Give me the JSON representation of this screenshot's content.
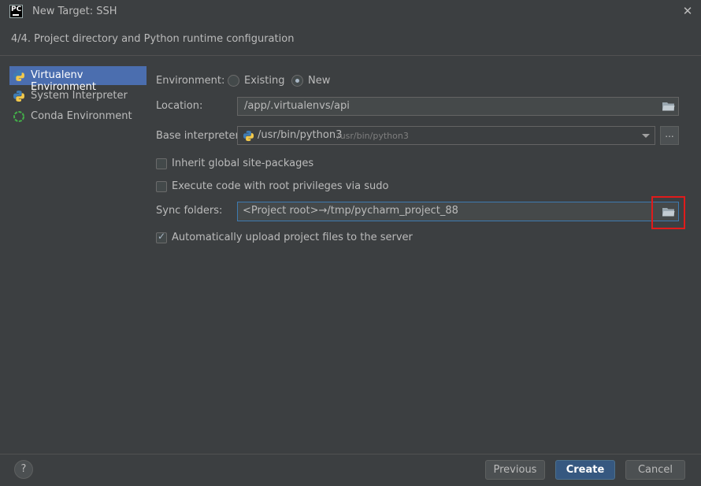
{
  "window": {
    "app_icon_text": "PC",
    "title": "New Target: SSH",
    "close_symbol": "✕"
  },
  "header": {
    "step_title": "4/4. Project directory and Python runtime configuration"
  },
  "sidebar": {
    "items": [
      {
        "label": "Virtualenv Environment",
        "icon": "python-icon",
        "selected": true
      },
      {
        "label": "System Interpreter",
        "icon": "python-icon",
        "selected": false
      },
      {
        "label": "Conda Environment",
        "icon": "conda-icon",
        "selected": false
      }
    ]
  },
  "form": {
    "environment_label": "Environment:",
    "environment_options": [
      {
        "label": "Existing",
        "selected": false
      },
      {
        "label": "New",
        "selected": true
      }
    ],
    "location_label": "Location:",
    "location_value": "/app/.virtualenvs/api",
    "base_interpreter_label": "Base interpreter:",
    "base_interpreter_value": "/usr/bin/python3",
    "base_interpreter_hint": "/usr/bin/python3",
    "more_button": "...",
    "inherit_label": "Inherit global site-packages",
    "inherit_checked": false,
    "sudo_label": "Execute code with root privileges via sudo",
    "sudo_checked": false,
    "sync_label": "Sync folders:",
    "sync_value": "<Project root>→/tmp/pycharm_project_88",
    "upload_label": "Automatically upload project files to the server",
    "upload_checked": true
  },
  "footer": {
    "help_symbol": "?",
    "previous_label": "Previous",
    "create_label": "Create",
    "cancel_label": "Cancel"
  },
  "colors": {
    "background": "#3c3f41",
    "selection": "#4b6eaf",
    "primary_button": "#365880",
    "highlight": "#e01b1b"
  }
}
